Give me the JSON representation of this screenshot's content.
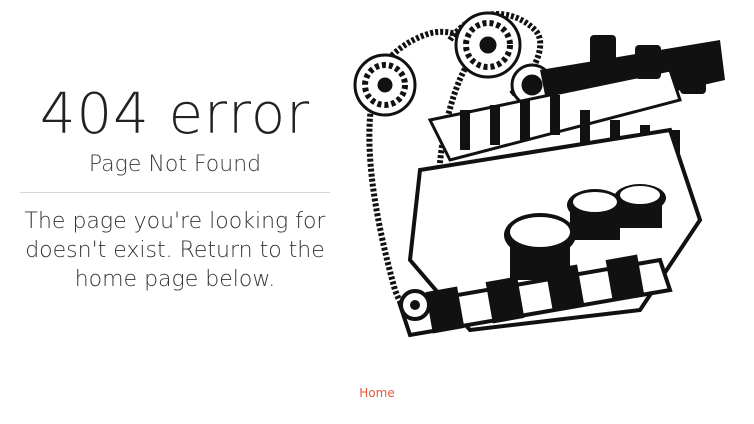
{
  "error": {
    "title": "404 error",
    "subtitle": "Page Not Found",
    "description": "The page you're looking for doesn't exist. Return to the home page below."
  },
  "illustration": {
    "icon": "engine-illustration"
  },
  "nav": {
    "home_label": "Home"
  },
  "colors": {
    "link": "#e8573a",
    "text": "#2b2b2b",
    "divider": "#d6d6d6"
  }
}
